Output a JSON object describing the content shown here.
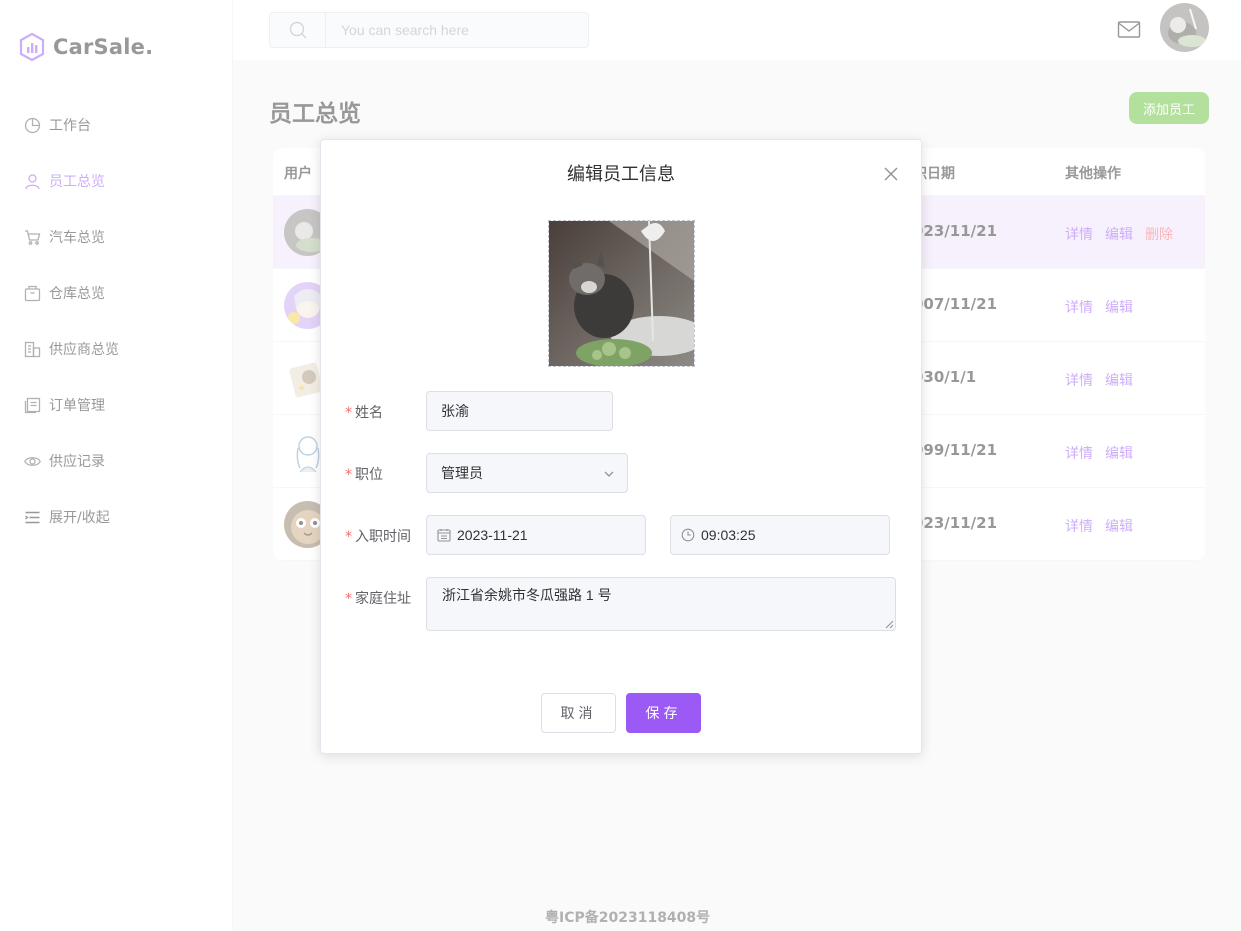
{
  "app": {
    "logo_text": "CarSale."
  },
  "sidebar": {
    "items": [
      {
        "label": "工作台",
        "icon": "pie-chart-icon"
      },
      {
        "label": "员工总览",
        "icon": "user-icon",
        "active": true
      },
      {
        "label": "汽车总览",
        "icon": "cart-icon"
      },
      {
        "label": "仓库总览",
        "icon": "box-icon"
      },
      {
        "label": "供应商总览",
        "icon": "building-icon"
      },
      {
        "label": "订单管理",
        "icon": "document-icon"
      },
      {
        "label": "供应记录",
        "icon": "eye-icon"
      },
      {
        "label": "展开/收起",
        "icon": "list-icon"
      }
    ]
  },
  "header": {
    "search_placeholder": "You can search here"
  },
  "main": {
    "title": "员工总览",
    "add_button": "添加员工",
    "table": {
      "col_user": "用户",
      "col_date": "职日期",
      "col_ops": "其他操作",
      "rows": [
        {
          "date": "023/11/21",
          "ops": [
            "详情",
            "编辑",
            "删除"
          ]
        },
        {
          "date": "007/11/21",
          "ops": [
            "详情",
            "编辑"
          ]
        },
        {
          "date": "030/1/1",
          "ops": [
            "详情",
            "编辑"
          ]
        },
        {
          "date": "099/11/21",
          "ops": [
            "详情",
            "编辑"
          ]
        },
        {
          "date": "023/11/21",
          "ops": [
            "详情",
            "编辑"
          ]
        }
      ]
    }
  },
  "footer": {
    "icp": "粤ICP备2023118408号"
  },
  "dialog": {
    "title": "编辑员工信息",
    "name_label": "姓名",
    "name_value": "张渝",
    "position_label": "职位",
    "position_value": "管理员",
    "join_label": "入职时间",
    "join_date": "2023-11-21",
    "join_time": "09:03:25",
    "address_label": "家庭住址",
    "address_value": "浙江省余姚市冬瓜强路 1 号",
    "cancel": "取消",
    "save": "保存"
  },
  "colors": {
    "accent": "#9b59f5",
    "success": "#67c23a",
    "danger": "#f56c6c"
  }
}
